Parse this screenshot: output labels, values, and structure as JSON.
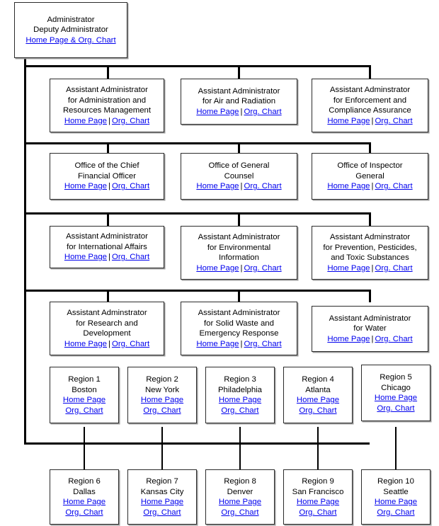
{
  "page": {
    "title": "EPA Organizational Chart",
    "link_color": "#0000ee",
    "line_color": "#000000",
    "box_border_color": "#2b2b2b"
  },
  "labels": {
    "home_page": "Home Page",
    "org_chart": "Org. Chart",
    "separator": "|"
  },
  "head": {
    "title": "Administrator\nDeputy Administrator",
    "combined_link": "Home Page & Org. Chart"
  },
  "rows": [
    {
      "row_id": "row-1",
      "nodes": [
        {
          "title": "Assistant Administrator\nfor Administration and\nResources Management",
          "home_page": "Home Page",
          "org_chart": "Org. Chart"
        },
        {
          "title": "Assistant Administrator\nfor Air and Radiation",
          "home_page": "Home Page",
          "org_chart": "Org. Chart"
        },
        {
          "title": "Assistant Adminstrator\nfor Enforcement and\nCompliance Assurance",
          "home_page": "Home Page",
          "org_chart": "Org. Chart"
        }
      ]
    },
    {
      "row_id": "row-2",
      "nodes": [
        {
          "title": "Office of the Chief\nFinancial Officer",
          "home_page": "Home Page",
          "org_chart": "Org. Chart"
        },
        {
          "title": "Office of General\nCounsel",
          "home_page": "Home Page",
          "org_chart": "Org. Chart"
        },
        {
          "title": "Office of Inspector\nGeneral",
          "home_page": "Home Page",
          "org_chart": "Org. Chart"
        }
      ]
    },
    {
      "row_id": "row-3",
      "nodes": [
        {
          "title": "Assistant Administrator\nfor International Affairs",
          "home_page": "Home Page",
          "org_chart": "Org. Chart"
        },
        {
          "title": "Assistant Administrator\nfor Environmental\nInformation",
          "home_page": "Home Page",
          "org_chart": "Org. Chart"
        },
        {
          "title": "Assistant Adminstrator\nfor Prevention, Pesticides,\nand Toxic Substances",
          "home_page": "Home Page",
          "org_chart": "Org. Chart"
        }
      ]
    },
    {
      "row_id": "row-4",
      "nodes": [
        {
          "title": "Assistant Adminstrator\nfor Research and\nDevelopment",
          "home_page": "Home Page",
          "org_chart": "Org. Chart"
        },
        {
          "title": "Assistant Administrator\nfor Solid Waste and\nEmergency Response",
          "home_page": "Home Page",
          "org_chart": "Org. Chart"
        },
        {
          "title": "Assistant Administrator\nfor Water",
          "home_page": "Home Page",
          "org_chart": "Org. Chart"
        }
      ]
    }
  ],
  "regions_row_1": [
    {
      "title": "Region 1\nBoston",
      "home_page": "Home Page",
      "org_chart": "Org. Chart"
    },
    {
      "title": "Region 2\nNew York",
      "home_page": "Home Page",
      "org_chart": "Org. Chart"
    },
    {
      "title": "Region 3\nPhiladelphia",
      "home_page": "Home Page",
      "org_chart": "Org. Chart"
    },
    {
      "title": "Region 4\nAtlanta",
      "home_page": "Home Page",
      "org_chart": "Org. Chart"
    },
    {
      "title": "Region 5\nChicago",
      "home_page": "Home Page",
      "org_chart": "Org. Chart"
    }
  ],
  "regions_row_2": [
    {
      "title": "Region 6\nDallas",
      "home_page": "Home Page",
      "org_chart": "Org. Chart"
    },
    {
      "title": "Region 7\nKansas City",
      "home_page": "Home Page",
      "org_chart": "Org. Chart"
    },
    {
      "title": "Region 8\nDenver",
      "home_page": "Home Page",
      "org_chart": "Org. Chart"
    },
    {
      "title": "Region 9\nSan Francisco",
      "home_page": "Home Page",
      "org_chart": "Org. Chart"
    },
    {
      "title": "Region 10\nSeattle",
      "home_page": "Home Page",
      "org_chart": "Org. Chart"
    }
  ]
}
